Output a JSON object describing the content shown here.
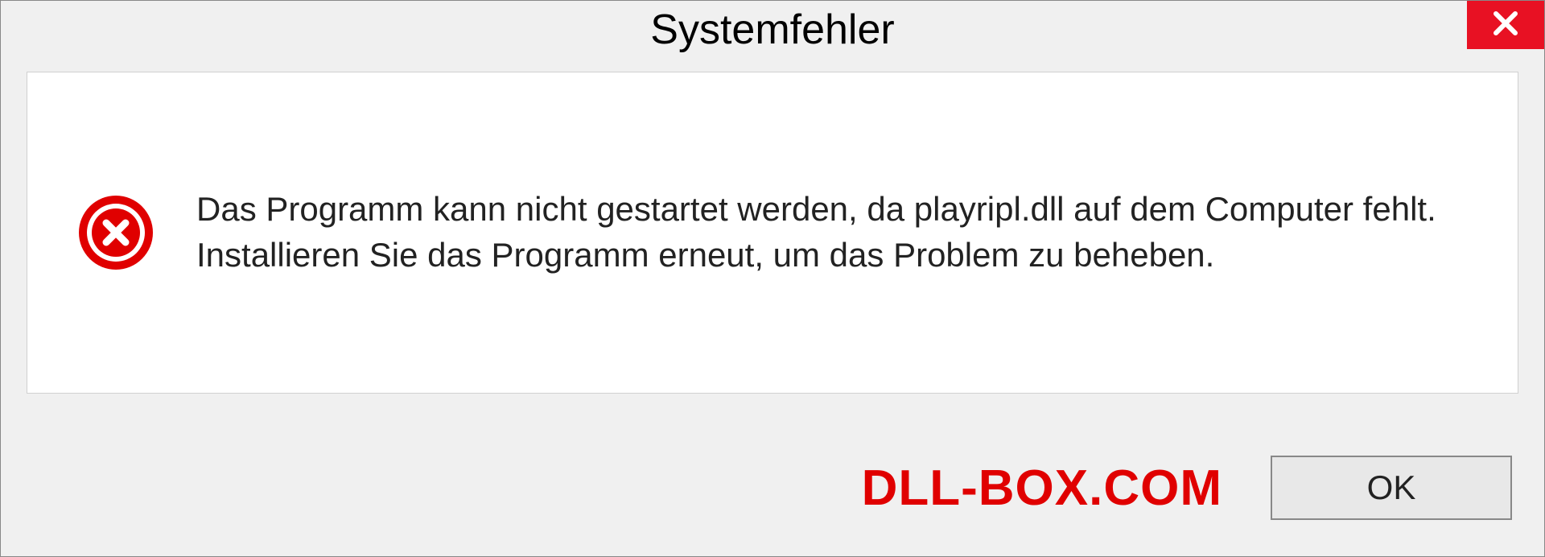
{
  "dialog": {
    "title": "Systemfehler",
    "message": "Das Programm kann nicht gestartet werden, da playripl.dll auf dem Computer fehlt. Installieren Sie das Programm erneut, um das Problem zu beheben.",
    "ok_label": "OK"
  },
  "watermark": "DLL-BOX.COM"
}
